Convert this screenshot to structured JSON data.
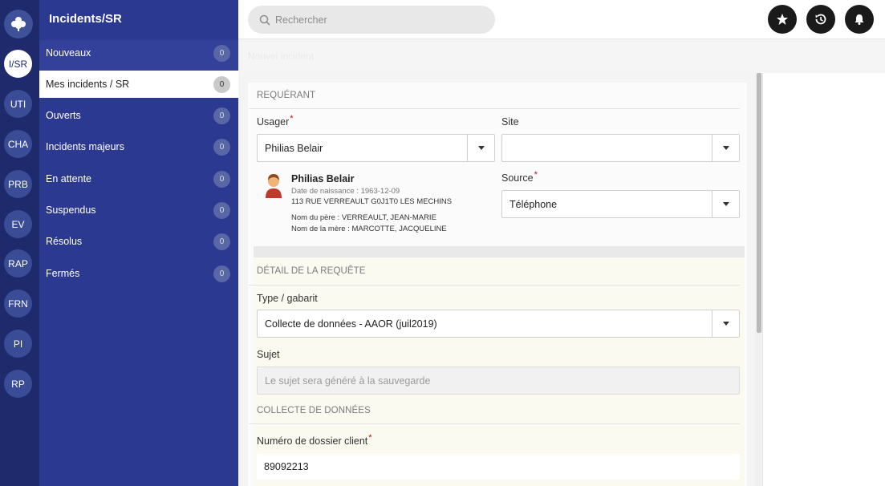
{
  "rail": {
    "items": [
      {
        "label": "I/SR",
        "active": true
      },
      {
        "label": "UTI"
      },
      {
        "label": "CHA"
      },
      {
        "label": "PRB"
      },
      {
        "label": "EV"
      },
      {
        "label": "RAP"
      },
      {
        "label": "FRN"
      },
      {
        "label": "PI"
      },
      {
        "label": "RP"
      }
    ]
  },
  "sidebar": {
    "title": "Incidents/SR",
    "items": [
      {
        "label": "Nouveaux",
        "count": "0"
      },
      {
        "label": "Mes incidents / SR",
        "count": "0",
        "active": true
      },
      {
        "label": "Ouverts",
        "count": "0"
      },
      {
        "label": "Incidents majeurs",
        "count": "0"
      },
      {
        "label": "En attente",
        "count": "0"
      },
      {
        "label": "Suspendus",
        "count": "0"
      },
      {
        "label": "Résolus",
        "count": "0"
      },
      {
        "label": "Fermés",
        "count": "0"
      }
    ]
  },
  "topbar": {
    "search_placeholder": "Rechercher"
  },
  "breadcrumb": "Nouvel incident",
  "requerant": {
    "title": "REQUÉRANT",
    "usager_label": "Usager",
    "usager_value": "Philias Belair",
    "site_label": "Site",
    "site_value": "",
    "source_label": "Source",
    "source_value": "Téléphone",
    "person": {
      "name": "Philias Belair",
      "birth": "Date de naissance : 1963-12-09",
      "address": "113 RUE VERREAULT G0J1T0 LES MECHINS",
      "father": "Nom du père : VERREAULT, JEAN-MARIE",
      "mother": "Nom de la mère : MARCOTTE, JACQUELINE"
    }
  },
  "detail": {
    "title": "DÉTAIL DE LA REQUÊTE",
    "type_label": "Type / gabarit",
    "type_value": "Collecte de données - AAOR (juil2019)",
    "sujet_label": "Sujet",
    "sujet_placeholder": "Le sujet sera généré à la sauvegarde"
  },
  "collecte": {
    "title": "COLLECTE DE DONNÉES",
    "dossier_label": "Numéro de dossier client",
    "dossier_value": "89092213"
  },
  "colors": {
    "rail": "#1e2a6b",
    "sidebar": "#2c3991",
    "required": "#d0021b"
  }
}
